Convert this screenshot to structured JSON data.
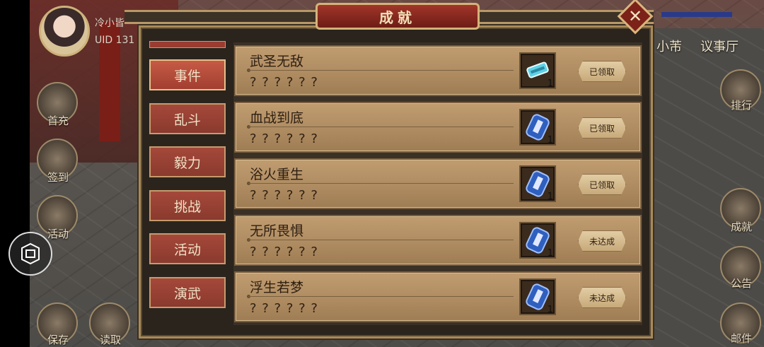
{
  "player": {
    "name": "冷小皆",
    "uid": "UID  131"
  },
  "left_menu": [
    {
      "label": "首充",
      "icon": "gift-icon"
    },
    {
      "label": "签到",
      "icon": "calendar-icon"
    },
    {
      "label": "活动",
      "icon": "event-icon"
    },
    {
      "label": "保存",
      "icon": "save-icon"
    },
    {
      "label": "读取",
      "icon": "load-icon"
    }
  ],
  "right_nav": {
    "items": [
      "小芾",
      "议事厅"
    ]
  },
  "right_menu": [
    {
      "label": "排行",
      "icon": "ranking-icon"
    },
    {
      "label": "成就",
      "icon": "achievement-icon"
    },
    {
      "label": "公告",
      "icon": "notice-icon"
    },
    {
      "label": "邮件",
      "icon": "mail-icon"
    }
  ],
  "modal": {
    "title": "成就",
    "tabs": [
      {
        "label": "事件",
        "active": true
      },
      {
        "label": "乱斗",
        "active": false
      },
      {
        "label": "毅力",
        "active": false
      },
      {
        "label": "挑战",
        "active": false
      },
      {
        "label": "活动",
        "active": false
      },
      {
        "label": "演武",
        "active": false
      }
    ],
    "achievements": [
      {
        "name": "武圣无敌",
        "desc": "? ? ? ? ? ?",
        "reward_count": "1",
        "reward_icon": "jade-token-icon",
        "status": "已领取"
      },
      {
        "name": "血战到底",
        "desc": "? ? ? ? ? ?",
        "reward_count": "1",
        "reward_icon": "scroll-icon",
        "status": "已领取"
      },
      {
        "name": "浴火重生",
        "desc": "? ? ? ? ? ?",
        "reward_count": "1",
        "reward_icon": "scroll-icon",
        "status": "已领取"
      },
      {
        "name": "无所畏惧",
        "desc": "? ? ? ? ? ?",
        "reward_count": "1",
        "reward_icon": "scroll-icon",
        "status": "未达成"
      },
      {
        "name": "浮生若梦",
        "desc": "? ? ? ? ? ?",
        "reward_count": "1",
        "reward_icon": "scroll-icon",
        "status": "未达成"
      }
    ]
  },
  "colors": {
    "accent_red": "#a2352a",
    "gold_border": "#d4b27a",
    "row_bg": "#c09c70"
  }
}
